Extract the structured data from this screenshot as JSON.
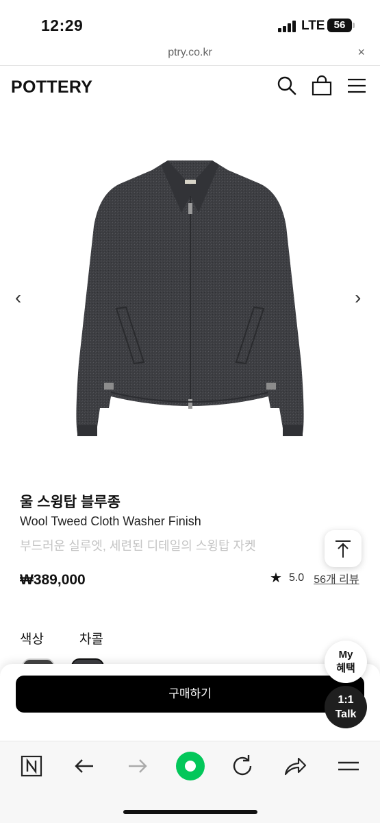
{
  "status_bar": {
    "time": "12:29",
    "network": "LTE",
    "battery": "56"
  },
  "browser": {
    "url": "ptry.co.kr",
    "close_label": "×"
  },
  "site": {
    "logo": "POTTERY"
  },
  "gallery": {
    "prev_label": "‹",
    "next_label": "›"
  },
  "product": {
    "name_ko": "울 스윙탑 블루종",
    "name_en": "Wool Tweed Cloth Washer Finish",
    "description": "부드러운 실루엣, 세련된 디테일의 스윙탑 자켓",
    "price": "₩389,000",
    "rating": "5.0",
    "reviews": "56개 리뷰"
  },
  "options": {
    "color_label": "색상",
    "color_value": "차콜"
  },
  "purchase": {
    "buy_label": "구매하기"
  },
  "floating": {
    "benefit_line1": "My",
    "benefit_line2": "혜택",
    "talk_line1": "1:1",
    "talk_line2": "Talk"
  },
  "colors": {
    "accent": "#000000",
    "jacket": "#3c3d41",
    "naver_green": "#03c75a"
  }
}
